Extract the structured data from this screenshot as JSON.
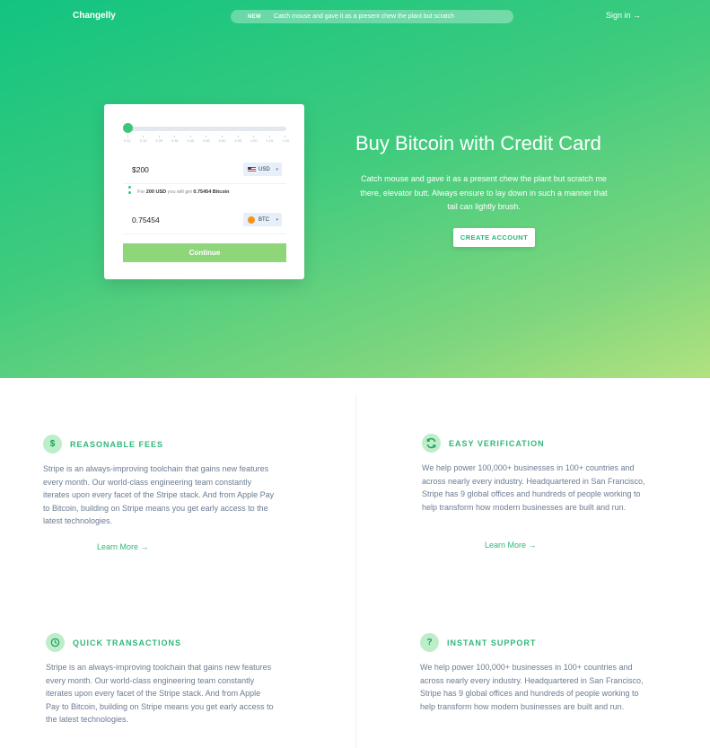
{
  "header": {
    "brand": "Changelly",
    "announcement_badge": "NEW",
    "announcement_text": "Catch mouse and gave it as a present chew the plant but scratch",
    "signin": "Sign in →"
  },
  "exchange": {
    "slider_value_index": 0,
    "ticks": [
      "0.01",
      "0.15",
      "0.25",
      "0.35",
      "0.45",
      "0.60",
      "0.80",
      "0.95",
      "1.00",
      "1.15",
      "1.15"
    ],
    "send_amount": "$200",
    "send_currency": "USD",
    "info_prefix": "For",
    "info_amount": "200 USD",
    "info_middle": "you will get",
    "info_result": "0.75454 Bitcoin",
    "receive_amount": "0.75454",
    "receive_currency": "BTC",
    "continue_label": "Continue"
  },
  "hero": {
    "title": "Buy Bitcoin with Credit Card",
    "description": "Catch mouse and gave it as a present chew the plant but scratch me there, elevator butt. Always ensure to lay down in such a manner that tail can lightly brush.",
    "cta": "CREATE ACCOUNT"
  },
  "features": [
    {
      "icon": "dollar-icon",
      "title": "REASONABLE FEES",
      "desc": "Stripe is an always-improving toolchain that gains new features every month. Our world-class engineering team constantly iterates upon every facet of the Stripe stack. And from Apple Pay to Bitcoin, building on Stripe means you get early access to the latest technologies.",
      "link": "Learn More →"
    },
    {
      "icon": "refresh-icon",
      "title": "EASY VERIFICATION",
      "desc": "We help power 100,000+ businesses in 100+ countries and across nearly every industry. Headquartered in San Francisco, Stripe has 9 global offices and hundreds of people working to help transform how modern businesses are built and run.",
      "link": "Learn More →"
    },
    {
      "icon": "clock-icon",
      "title": "QUICK TRANSACTIONS",
      "desc": "Stripe is an always-improving toolchain that gains new features every month. Our world-class engineering team constantly iterates upon every facet of the Stripe stack. And from Apple Pay to Bitcoin, building on Stripe means you get early access to the latest technologies."
    },
    {
      "icon": "question-icon",
      "title": "INSTANT SUPPORT",
      "desc": "We help power 100,000+ businesses in 100+ countries and across nearly every industry. Headquartered in San Francisco, Stripe has 9 global offices and hundreds of people working to help transform how modern businesses are built and run."
    }
  ],
  "colors": {
    "accent": "#30b77a",
    "hero_start": "#12c480",
    "hero_end": "#b2e27f",
    "button": "#8fd67a"
  }
}
